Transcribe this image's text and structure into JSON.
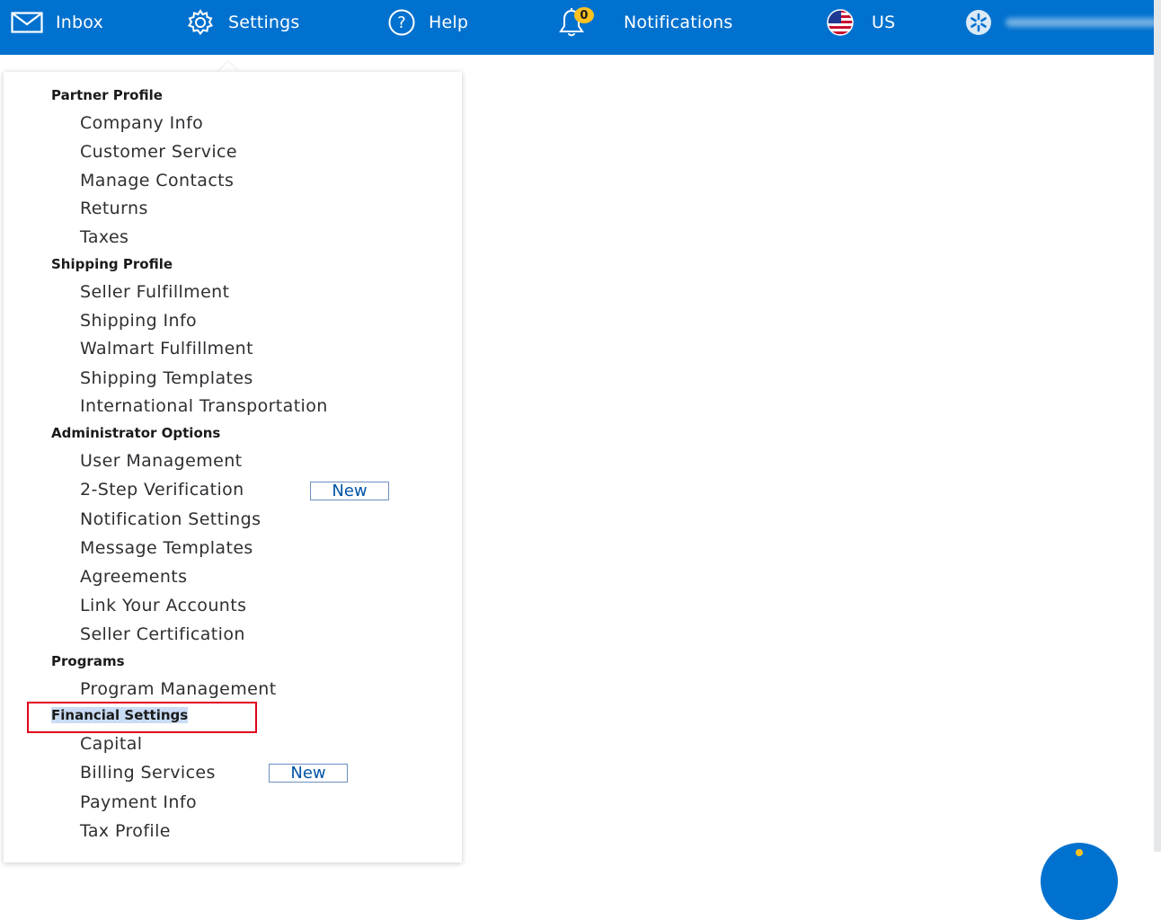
{
  "header": {
    "inbox_label": "Inbox",
    "settings_label": "Settings",
    "help_label": "Help",
    "notifications_label": "Notifications",
    "notifications_count": "0",
    "region_label": "US",
    "brand_color": "#0071ce",
    "badge_color": "#ffc220"
  },
  "menu": {
    "partner_profile": {
      "title": "Partner Profile",
      "items": [
        "Company Info",
        "Customer Service",
        "Manage Contacts",
        "Returns",
        "Taxes"
      ]
    },
    "shipping_profile": {
      "title": "Shipping Profile",
      "items": [
        "Seller Fulfillment",
        "Shipping Info",
        "Walmart Fulfillment",
        "Shipping Templates",
        "International Transportation"
      ]
    },
    "administrator_options": {
      "title": "Administrator Options",
      "items": [
        "User Management",
        "2-Step Verification",
        "Notification Settings",
        "Message Templates",
        "Agreements",
        "Link Your Accounts",
        "Seller Certification"
      ]
    },
    "programs": {
      "title": "Programs",
      "items": [
        "Program Management"
      ]
    },
    "financial_settings": {
      "title": "Financial Settings",
      "items": [
        "Capital",
        "Billing Services",
        "Payment Info",
        "Tax Profile"
      ]
    },
    "new_tag_label": "New"
  },
  "icons": {
    "inbox": "envelope-icon",
    "settings": "gear-icon",
    "help": "question-circle-icon",
    "notifications": "bell-icon",
    "region": "us-flag-icon",
    "account": "spark-icon"
  }
}
